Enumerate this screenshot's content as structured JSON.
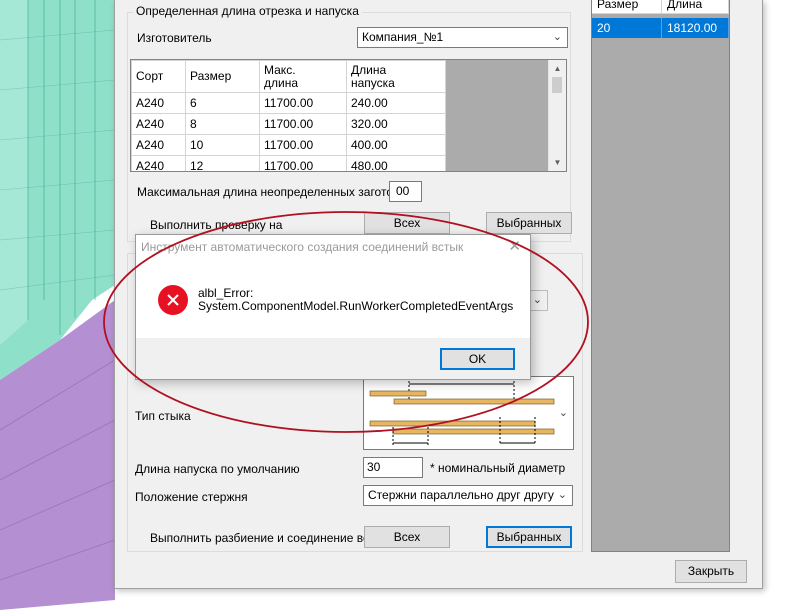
{
  "settings_section": {
    "title": "Определенная длина отрезка и напуска",
    "manufacturer_label": "Изготовитель",
    "manufacturer_value": "Компания_№1",
    "grid_headers": [
      "Сорт",
      "Размер",
      "Макс. длина",
      "Длина напуска"
    ],
    "grid_rows": [
      [
        "A240",
        "6",
        "11700.00",
        "240.00"
      ],
      [
        "A240",
        "8",
        "11700.00",
        "320.00"
      ],
      [
        "A240",
        "10",
        "11700.00",
        "400.00"
      ],
      [
        "A240",
        "12",
        "11700.00",
        "480.00"
      ]
    ],
    "max_length_label": "Максимальная длина неопределенных заготовок",
    "max_length_value": "00",
    "check_label": "Выполнить проверку на",
    "all_button": "Всех",
    "selected_button": "Выбранных"
  },
  "right_list": {
    "headers": [
      "Размер",
      "Длина"
    ],
    "rows": [
      [
        "20",
        "18120.00"
      ]
    ]
  },
  "joint_section": {
    "joint_type_label": "Тип стыка",
    "default_lap_label": "Длина напуска по умолчанию",
    "default_lap_value": "30",
    "diameter_suffix": "* номинальный диаметр",
    "position_label": "Положение стержня",
    "position_value": "Стержни параллельно друг другу",
    "split_label": "Выполнить разбиение и соединение встык на",
    "all_button": "Всех",
    "selected_button": "Выбранных"
  },
  "footer": {
    "close_button": "Закрыть"
  },
  "dialog": {
    "title": "Инструмент автоматического создания соединений встык",
    "message_line1": "albl_Error:",
    "message_line2": "System.ComponentModel.RunWorkerCompletedEventArgs",
    "ok_button": "OK",
    "icon": "error-icon",
    "close_icon": "close-icon"
  },
  "colors": {
    "accent": "#0078d7",
    "error": "#e81123",
    "annotation": "#b01020",
    "viewport_teal": "#8fe0c8",
    "viewport_purple": "#b48fd2"
  }
}
